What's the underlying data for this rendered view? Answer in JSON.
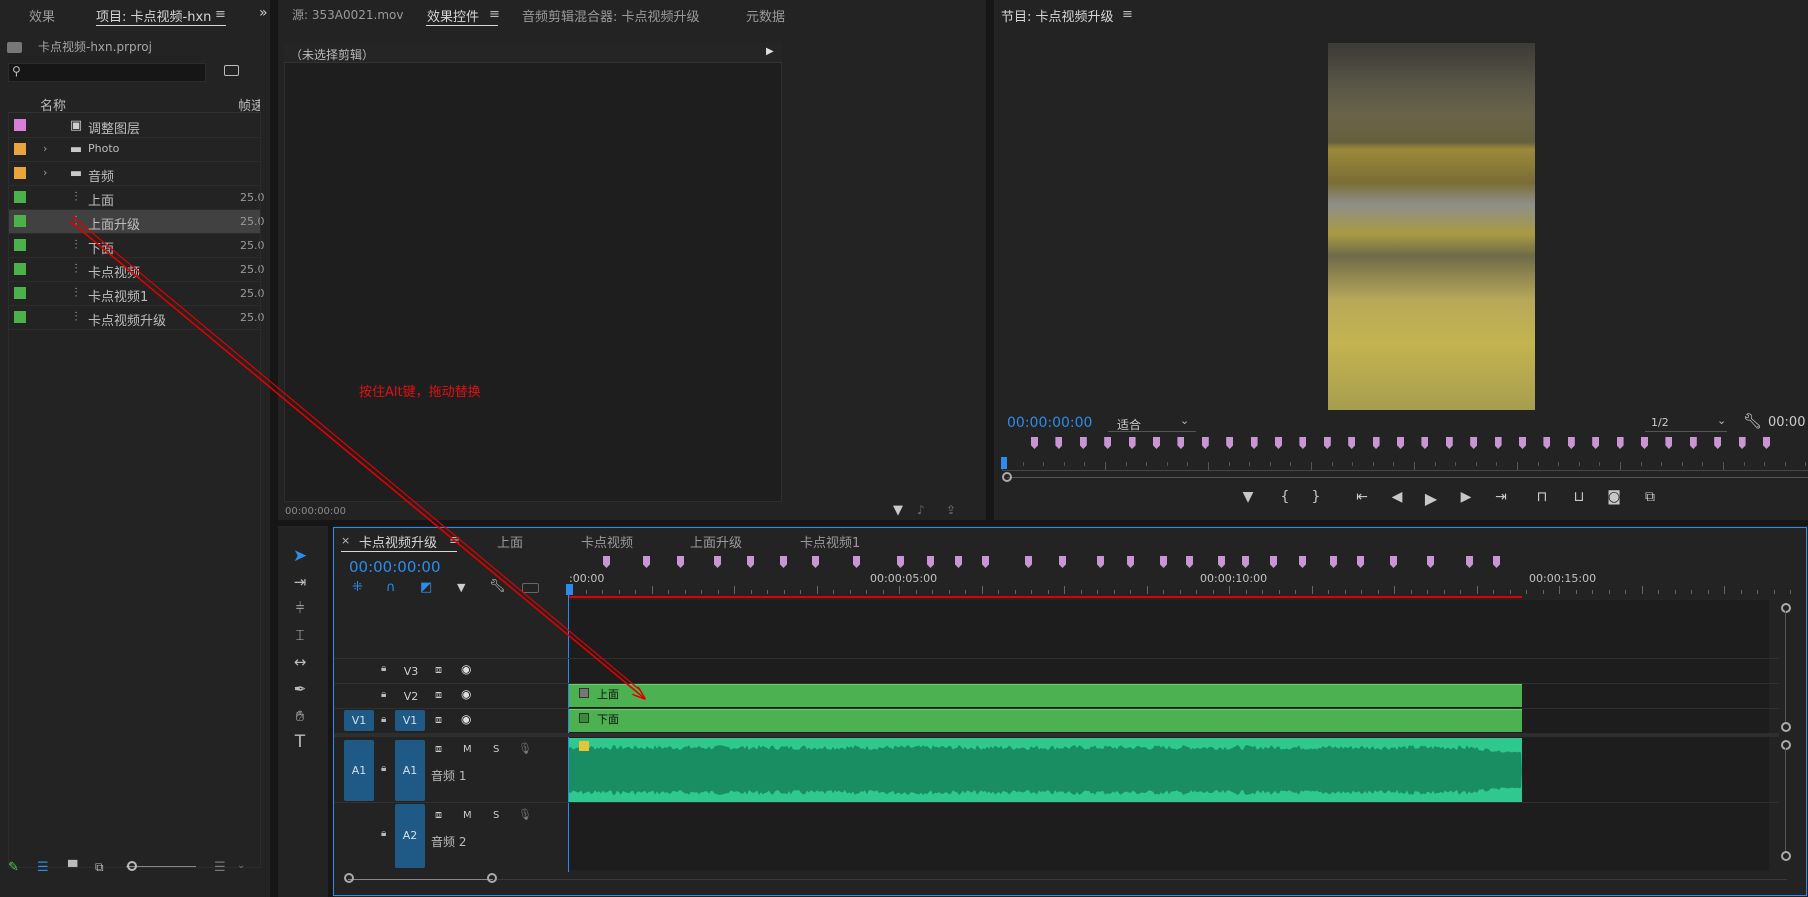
{
  "left_panel": {
    "tabs": [
      "效果",
      "项目: 卡点视频-hxn"
    ],
    "project_file": "卡点视频-hxn.prproj",
    "search_placeholder": "",
    "columns": [
      "名称",
      "帧速"
    ],
    "items": [
      {
        "color": "#d77fd8",
        "icon": "adjustment-layer-icon",
        "name": "调整图层",
        "rate": "",
        "expander": false,
        "selected": false
      },
      {
        "color": "#e9a43f",
        "icon": "folder-icon",
        "name": "Photo",
        "rate": "",
        "expander": true,
        "selected": false
      },
      {
        "color": "#e9a43f",
        "icon": "folder-icon",
        "name": "音频",
        "rate": "",
        "expander": true,
        "selected": false
      },
      {
        "color": "#4bb14b",
        "icon": "sequence-icon",
        "name": "上面",
        "rate": "25.0",
        "expander": false,
        "selected": false
      },
      {
        "color": "#4bb14b",
        "icon": "sequence-icon",
        "name": "上面升级",
        "rate": "25.0",
        "expander": false,
        "selected": true
      },
      {
        "color": "#4bb14b",
        "icon": "sequence-icon",
        "name": "下面",
        "rate": "25.0",
        "expander": false,
        "selected": false
      },
      {
        "color": "#4bb14b",
        "icon": "sequence-icon",
        "name": "卡点视频",
        "rate": "25.0",
        "expander": false,
        "selected": false
      },
      {
        "color": "#4bb14b",
        "icon": "sequence-icon",
        "name": "卡点视频1",
        "rate": "25.0",
        "expander": false,
        "selected": false
      },
      {
        "color": "#4bb14b",
        "icon": "sequence-icon",
        "name": "卡点视频升级",
        "rate": "25.0",
        "expander": false,
        "selected": false
      }
    ]
  },
  "source_panel": {
    "tabs": [
      "源: 353A0021.mov",
      "效果控件",
      "音频剪辑混合器: 卡点视频升级",
      "元数据"
    ],
    "no_clip": "（未选择剪辑）",
    "timecode": "00:00:00:00"
  },
  "annotation": "按住Alt键，拖动替换",
  "program_panel": {
    "title": "节目: 卡点视频升级",
    "timecode": "00:00:00:00",
    "fit": "适合",
    "resolution": "1/2",
    "right_timecode": "00:00",
    "markers_count": 31
  },
  "timeline": {
    "tabs": [
      "卡点视频升级",
      "上面",
      "卡点视频",
      "上面升级",
      "卡点视频1"
    ],
    "timecode": "00:00:00:00",
    "ruler_labels": [
      ":00:00",
      "00:00:05:00",
      "00:00:10:00",
      "00:00:15:00"
    ],
    "tracks": [
      {
        "name": "V3"
      },
      {
        "name": "V2"
      },
      {
        "name": "V1",
        "source": "V1"
      },
      {
        "name": "A1",
        "source": "A1",
        "label": "音频 1"
      },
      {
        "name": "A2",
        "label": "音频 2"
      }
    ],
    "clips": {
      "v2": "上面",
      "v1": "下面"
    },
    "track_buttons": {
      "m": "M",
      "s": "S"
    }
  },
  "colors": {
    "accent": "#2d8ceb",
    "clip_video": "#4cb150",
    "clip_audio": "#2fc98f",
    "marker": "#c996d3",
    "arrow": "#e00000"
  }
}
